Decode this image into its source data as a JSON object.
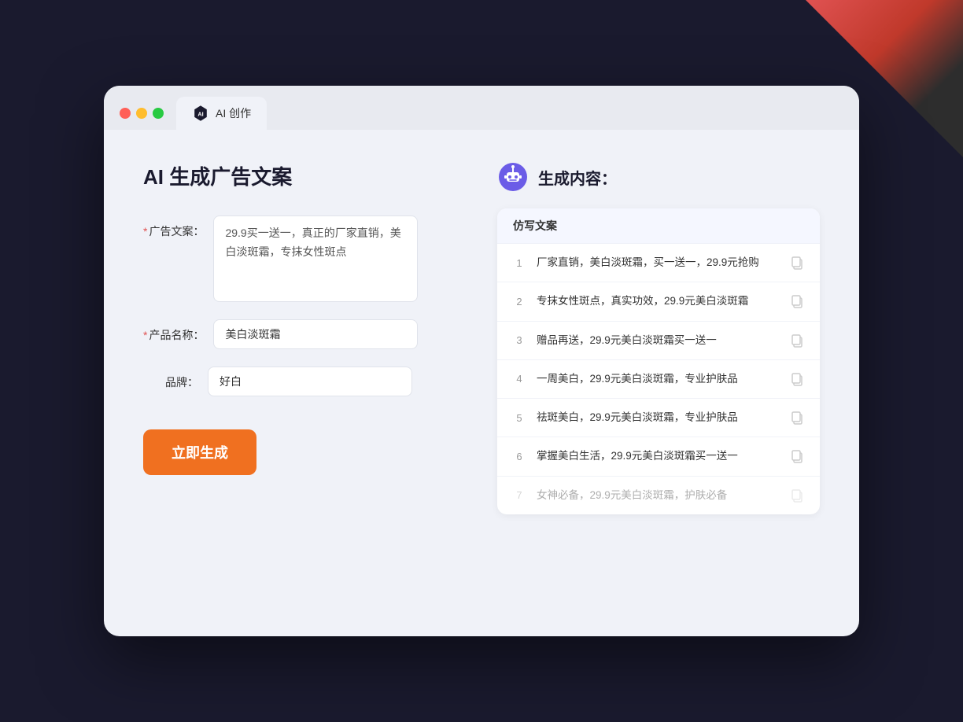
{
  "background": {
    "color": "#1a1a2e"
  },
  "browser": {
    "tab_label": "AI 创作",
    "window_title": "AI 生成广告文案"
  },
  "form": {
    "title": "AI 生成广告文案",
    "ad_copy_label": "广告文案：",
    "ad_copy_required": "*",
    "ad_copy_value": "29.9买一送一，真正的厂家直销，美白淡斑霜，专抹女性斑点",
    "product_name_label": "产品名称：",
    "product_name_required": "*",
    "product_name_value": "美白淡斑霜",
    "brand_label": "品牌：",
    "brand_value": "好白",
    "generate_btn_label": "立即生成"
  },
  "results": {
    "header_icon": "robot",
    "header_title": "生成内容：",
    "column_label": "仿写文案",
    "items": [
      {
        "num": 1,
        "text": "厂家直销，美白淡斑霜，买一送一，29.9元抢购",
        "faded": false
      },
      {
        "num": 2,
        "text": "专抹女性斑点，真实功效，29.9元美白淡斑霜",
        "faded": false
      },
      {
        "num": 3,
        "text": "赠品再送，29.9元美白淡斑霜买一送一",
        "faded": false
      },
      {
        "num": 4,
        "text": "一周美白，29.9元美白淡斑霜，专业护肤品",
        "faded": false
      },
      {
        "num": 5,
        "text": "祛斑美白，29.9元美白淡斑霜，专业护肤品",
        "faded": false
      },
      {
        "num": 6,
        "text": "掌握美白生活，29.9元美白淡斑霜买一送一",
        "faded": false
      },
      {
        "num": 7,
        "text": "女神必备，29.9元美白淡斑霜，护肤必备",
        "faded": true
      }
    ]
  }
}
